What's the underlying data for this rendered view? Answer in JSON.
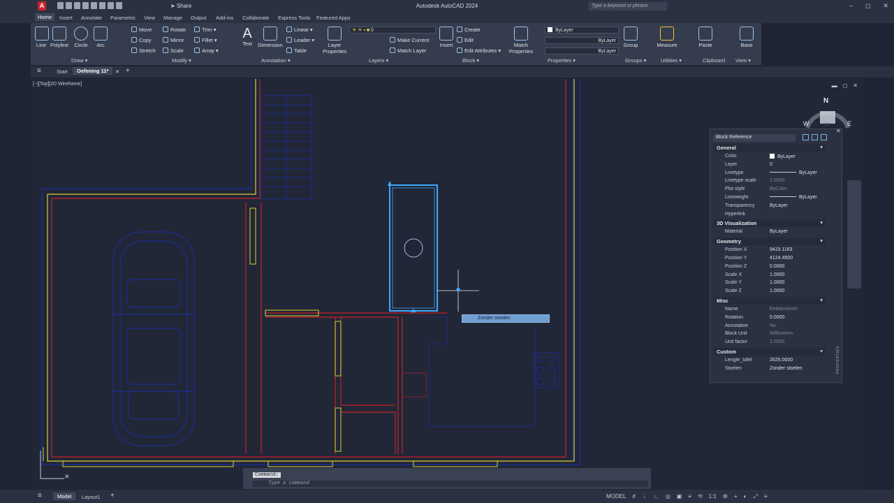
{
  "app": {
    "title": "Autodesk AutoCAD 2024",
    "logo": "A",
    "share_label": "Share",
    "search_placeholder": "Type a keyword or phrase",
    "window_controls": [
      "–",
      "◻",
      "✕"
    ]
  },
  "ribbon_tabs": [
    "Home",
    "Insert",
    "Annotate",
    "Parametric",
    "View",
    "Manage",
    "Output",
    "Add-ins",
    "Collaborate",
    "Express Tools",
    "Featured Apps"
  ],
  "ribbon": {
    "draw": {
      "title": "Draw ▾",
      "line": "Line",
      "polyline": "Polyline",
      "circle": "Circle",
      "arc": "Arc"
    },
    "modify": {
      "title": "Modify ▾",
      "move": "Move",
      "rotate": "Rotate",
      "trim": "Trim ▾",
      "copy": "Copy",
      "mirror": "Mirror",
      "fillet": "Fillet ▾",
      "stretch": "Stretch",
      "scale": "Scale",
      "array": "Array ▾"
    },
    "annotation": {
      "title": "Annotation ▾",
      "text": "Text",
      "dimension": "Dimension",
      "linear": "Linear ▾",
      "leader": "Leader ▾",
      "table": "Table"
    },
    "layers": {
      "title": "Layers ▾",
      "layer_properties_1": "Layer",
      "layer_properties_2": "Properties",
      "layer_value": "0",
      "make_current": "Make Current",
      "match_layer": "Match Layer"
    },
    "block": {
      "title": "Block ▾",
      "insert": "Insert",
      "create": "Create",
      "edit": "Edit",
      "edit_attributes": "Edit Attributes ▾"
    },
    "properties": {
      "title": "Properties ▾",
      "match_1": "Match",
      "match_2": "Properties",
      "color": "ByLayer",
      "linetype": "ByLayer",
      "lineweight": "ByLayer"
    },
    "groups": {
      "title": "Groups ▾",
      "group": "Group"
    },
    "utilities": {
      "title": "Utilities ▾",
      "measure": "Measure"
    },
    "clipboard": {
      "title": "Clipboard",
      "paste": "Paste"
    },
    "view": {
      "title": "View ▾",
      "base": "Base"
    }
  },
  "doc_tabs": {
    "start": "Start",
    "active": "Oefening 11*",
    "add": "+"
  },
  "viewport": {
    "label": "[−][Top][2D Wireframe]",
    "compass_n": "N",
    "compass_w": "W",
    "compass_e": "E",
    "cube_top": "TOP"
  },
  "tooltip": {
    "text": "Zonder stoelen"
  },
  "properties_palette": {
    "selection": "Block Reference",
    "side_label": "PROPERTIES",
    "sections": [
      {
        "title": "General",
        "rows": [
          {
            "key": "Color",
            "value": "ByLayer",
            "swatch": "#ffffff"
          },
          {
            "key": "Layer",
            "value": "0"
          },
          {
            "key": "Linetype",
            "value": "ByLayer",
            "line": true
          },
          {
            "key": "Linetype scale",
            "value": "1.0000",
            "dim": true
          },
          {
            "key": "Plot style",
            "value": "ByColor",
            "dim": true
          },
          {
            "key": "Lineweight",
            "value": "ByLayer",
            "line": true
          },
          {
            "key": "Transparency",
            "value": "ByLayer"
          },
          {
            "key": "Hyperlink",
            "value": ""
          }
        ]
      },
      {
        "title": "3D Visualization",
        "rows": [
          {
            "key": "Material",
            "value": "ByLayer"
          }
        ]
      },
      {
        "title": "Geometry",
        "rows": [
          {
            "key": "Position X",
            "value": "9415.1163"
          },
          {
            "key": "Position Y",
            "value": "4124.4500"
          },
          {
            "key": "Position Z",
            "value": "0.0000"
          },
          {
            "key": "Scale X",
            "value": "1.0000"
          },
          {
            "key": "Scale Y",
            "value": "1.0000"
          },
          {
            "key": "Scale Z",
            "value": "1.0000"
          }
        ]
      },
      {
        "title": "Misc",
        "rows": [
          {
            "key": "Name",
            "value": "Eetkamerset",
            "dim": true
          },
          {
            "key": "Rotation",
            "value": "0.0000"
          },
          {
            "key": "Annotative",
            "value": "No",
            "dim": true
          },
          {
            "key": "Block Unit",
            "value": "Millimeters",
            "dim": true
          },
          {
            "key": "Unit factor",
            "value": "1.0000",
            "dim": true
          }
        ]
      },
      {
        "title": "Custom",
        "rows": [
          {
            "key": "Lengte_tafel",
            "value": "2625.0000"
          },
          {
            "key": "Stoelen",
            "value": "Zonder stoelen"
          }
        ]
      }
    ]
  },
  "command": {
    "history": "Command:",
    "placeholder": "Type a command"
  },
  "status": {
    "model_tab": "Model",
    "layout_tab": "Layout1",
    "add": "+",
    "model_label": "MODEL",
    "scale": "1:1"
  },
  "colors": {
    "wall_red": "#c8202a",
    "wall_yellow": "#d8d23a",
    "blue_block": "#1a2ea8",
    "selected": "#3fa8ff",
    "background": "#212736"
  }
}
